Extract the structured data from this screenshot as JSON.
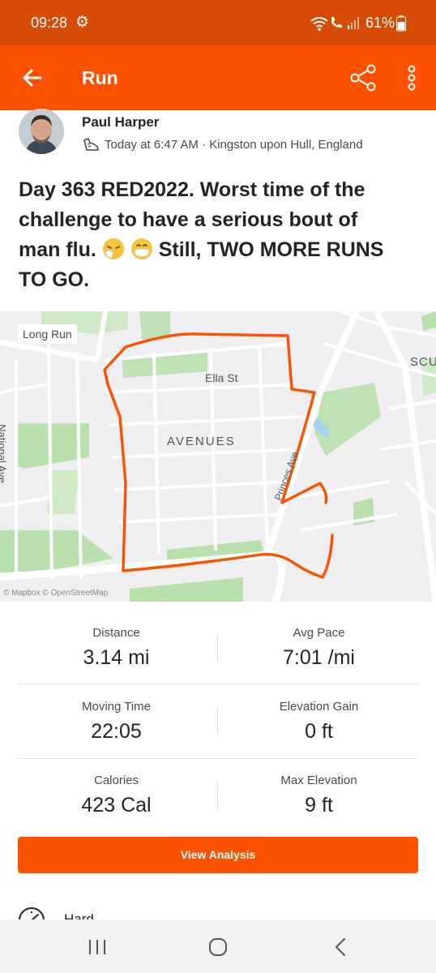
{
  "status_bar": {
    "time": "09:28",
    "battery": "61%",
    "background": "#d64c06"
  },
  "app_bar": {
    "title": "Run",
    "background": "#fc5200",
    "back_icon": "back-arrow-icon",
    "share_icon": "share-icon",
    "menu_icon": "overflow-menu-icon"
  },
  "athlete": {
    "name": "Paul Harper",
    "meta": "Today at 6:47 AM · Kingston upon Hull, England"
  },
  "activity": {
    "title_lines": [
      "Day 363 RED2022.  Worst time of the",
      "challenge to have a serious bout of",
      "man flu.",
      " Still, TWO MORE RUNS",
      "TO GO."
    ]
  },
  "map": {
    "tag": "Long Run",
    "labels": {
      "street_ella": "Ella St",
      "area": "AVENUES",
      "street_national": "National Ave",
      "street_princes": "Princes Ave",
      "edge": "SCU"
    },
    "attribution": "© Mapbox © OpenStreetMap",
    "route_color": "#fc5200"
  },
  "stats": [
    {
      "label": "Distance",
      "value": "3.14 mi"
    },
    {
      "label": "Avg Pace",
      "value": "7:01 /mi"
    },
    {
      "label": "Moving Time",
      "value": "22:05"
    },
    {
      "label": "Elevation Gain",
      "value": "0 ft"
    },
    {
      "label": "Calories",
      "value": "423 Cal"
    },
    {
      "label": "Max Elevation",
      "value": "9 ft"
    }
  ],
  "buttons": {
    "view_analysis": "View Analysis"
  },
  "perceived_exertion": {
    "label": "Hard"
  },
  "accent": "#fc5200"
}
